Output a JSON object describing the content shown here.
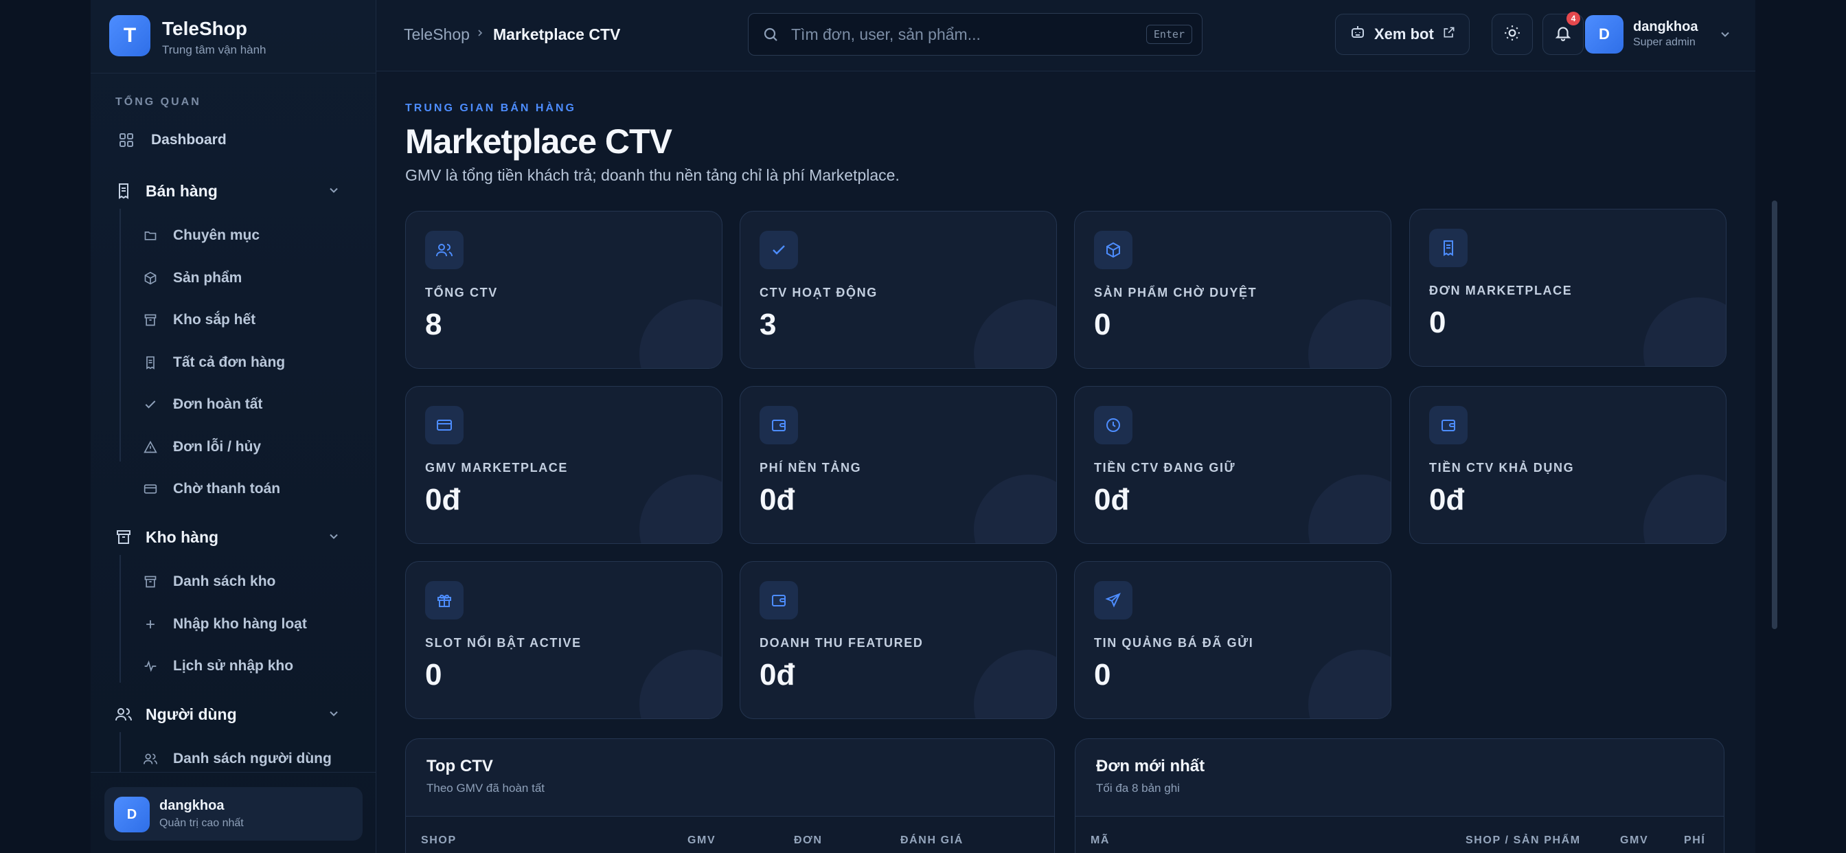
{
  "brand": {
    "logo_letter": "T",
    "name": "TeleShop",
    "subtitle": "Trung tâm vận hành"
  },
  "sidebar": {
    "section_overview": "TỔNG QUAN",
    "dashboard": "Dashboard",
    "groups": [
      {
        "label": "Bán hàng",
        "items": [
          "Chuyên mục",
          "Sản phẩm",
          "Kho sắp hết",
          "Tất cả đơn hàng",
          "Đơn hoàn tất",
          "Đơn lỗi / hủy",
          "Chờ thanh toán"
        ]
      },
      {
        "label": "Kho hàng",
        "items": [
          "Danh sách kho",
          "Nhập kho hàng loạt",
          "Lịch sử nhập kho"
        ]
      },
      {
        "label": "Người dùng",
        "items": [
          "Danh sách người dùng"
        ]
      }
    ],
    "user": {
      "avatar_letter": "D",
      "name": "dangkhoa",
      "role": "Quản trị cao nhất"
    }
  },
  "topbar": {
    "breadcrumb": [
      "TeleShop",
      "Marketplace CTV"
    ],
    "search_placeholder": "Tìm đơn, user, sản phẩm...",
    "search_kbd": "Enter",
    "view_bot": "Xem bot",
    "notification_count": "4",
    "user": {
      "avatar_letter": "D",
      "name": "dangkhoa",
      "role": "Super admin"
    }
  },
  "page": {
    "eyebrow": "TRUNG GIAN BÁN HÀNG",
    "title": "Marketplace CTV",
    "description": "GMV là tổng tiền khách trả; doanh thu nền tảng chỉ là phí Marketplace."
  },
  "stats": [
    {
      "label": "TỔNG CTV",
      "value": "8",
      "icon": "users-icon"
    },
    {
      "label": "CTV HOẠT ĐỘNG",
      "value": "3",
      "icon": "check-icon"
    },
    {
      "label": "SẢN PHẨM CHỜ DUYỆT",
      "value": "0",
      "icon": "box-icon"
    },
    {
      "label": "ĐƠN MARKETPLACE",
      "value": "0",
      "icon": "receipt-icon"
    },
    {
      "label": "GMV MARKETPLACE",
      "value": "0đ",
      "icon": "card-icon"
    },
    {
      "label": "PHÍ NỀN TẢNG",
      "value": "0đ",
      "icon": "wallet-icon"
    },
    {
      "label": "TIỀN CTV ĐANG GIỮ",
      "value": "0đ",
      "icon": "clock-icon"
    },
    {
      "label": "TIỀN CTV KHẢ DỤNG",
      "value": "0đ",
      "icon": "wallet-icon"
    },
    {
      "label": "SLOT NỔI BẬT ACTIVE",
      "value": "0",
      "icon": "gift-icon"
    },
    {
      "label": "DOANH THU FEATURED",
      "value": "0đ",
      "icon": "wallet-icon"
    },
    {
      "label": "TIN QUẢNG BÁ ĐÃ GỬI",
      "value": "0",
      "icon": "send-icon"
    }
  ],
  "top_ctv": {
    "title": "Top CTV",
    "subtitle": "Theo GMV đã hoàn tất",
    "columns": [
      "SHOP",
      "GMV",
      "ĐƠN",
      "ĐÁNH GIÁ"
    ]
  },
  "latest_orders": {
    "title": "Đơn mới nhất",
    "subtitle": "Tối đa 8 bản ghi",
    "columns": [
      "MÃ",
      "SHOP / SẢN PHẨM",
      "GMV",
      "PHÍ"
    ]
  },
  "colors": {
    "accent": "#4d8dff",
    "background": "#0d1829",
    "card": "#131f33",
    "badge": "#e5484d"
  }
}
